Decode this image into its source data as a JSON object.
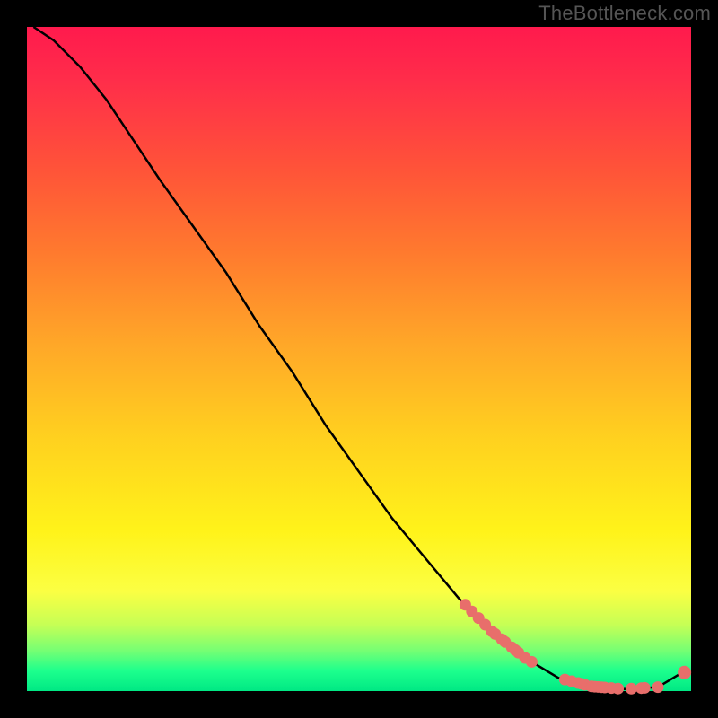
{
  "watermark": "TheBottleneck.com",
  "chart_data": {
    "type": "line",
    "title": "",
    "xlabel": "",
    "ylabel": "",
    "xlim": [
      0,
      100
    ],
    "ylim": [
      0,
      100
    ],
    "curve": [
      {
        "x": 1,
        "y": 100
      },
      {
        "x": 4,
        "y": 98
      },
      {
        "x": 8,
        "y": 94
      },
      {
        "x": 12,
        "y": 89
      },
      {
        "x": 16,
        "y": 83
      },
      {
        "x": 20,
        "y": 77
      },
      {
        "x": 25,
        "y": 70
      },
      {
        "x": 30,
        "y": 63
      },
      {
        "x": 35,
        "y": 55
      },
      {
        "x": 40,
        "y": 48
      },
      {
        "x": 45,
        "y": 40
      },
      {
        "x": 50,
        "y": 33
      },
      {
        "x": 55,
        "y": 26
      },
      {
        "x": 60,
        "y": 20
      },
      {
        "x": 65,
        "y": 14
      },
      {
        "x": 70,
        "y": 9
      },
      {
        "x": 75,
        "y": 5
      },
      {
        "x": 80,
        "y": 2
      },
      {
        "x": 85,
        "y": 0.7
      },
      {
        "x": 90,
        "y": 0.3
      },
      {
        "x": 95,
        "y": 0.6
      },
      {
        "x": 99,
        "y": 3
      }
    ],
    "points_on_curve_x": [
      66,
      67,
      68,
      69,
      70,
      70.5,
      71.5,
      72,
      73,
      73.5,
      74,
      75,
      76,
      81,
      82,
      83,
      83.5,
      84,
      85,
      85.5,
      86,
      86.5,
      87,
      88,
      89,
      91,
      92.5,
      93,
      95
    ],
    "extra_points": [
      {
        "x": 99,
        "y": 2.8
      }
    ],
    "colors": {
      "curve": "#000000",
      "points": "#e86e6b"
    }
  }
}
